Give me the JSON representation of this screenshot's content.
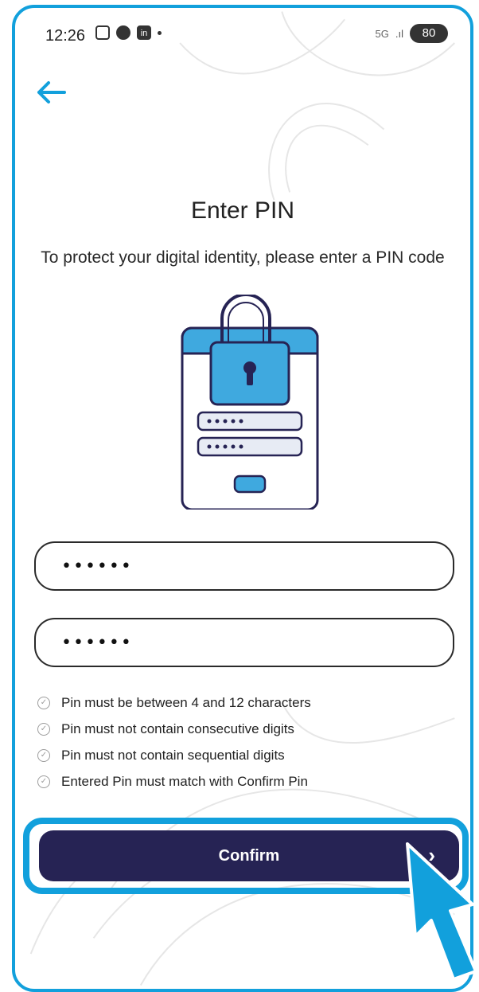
{
  "status_bar": {
    "time": "12:26",
    "signal": "5G",
    "battery": "80"
  },
  "header": {
    "back_icon": "arrow-left-icon"
  },
  "title": "Enter PIN",
  "subtitle": "To protect your digital identity, please enter a PIN code",
  "illustration_icon": "lock-form-illustration",
  "fields": {
    "pin": {
      "value": "••••••"
    },
    "confirm_pin": {
      "value": "••••••"
    }
  },
  "rules": [
    {
      "text": "Pin must be between 4 and 12 characters"
    },
    {
      "text": "Pin must not contain consecutive digits"
    },
    {
      "text": "Pin must not contain sequential digits"
    },
    {
      "text": "Entered Pin must match with Confirm Pin"
    }
  ],
  "confirm_button": {
    "label": "Confirm",
    "chevron": "›"
  },
  "colors": {
    "accent": "#12a0dc",
    "primary": "#262354",
    "text": "#222222",
    "rule_icon": "#9c9c9c"
  }
}
